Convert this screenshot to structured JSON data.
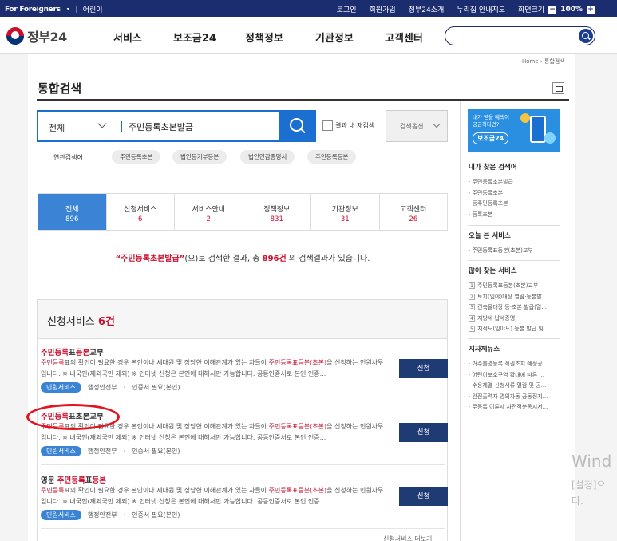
{
  "topbar": {
    "foreigners": "For Foreigners",
    "kids": "어린이",
    "login": "로그인",
    "join": "회원가입",
    "intro": "정부24소개",
    "map": "누리집 안내지도",
    "screen": "화면크기",
    "zoom": "100%",
    "minus": "−",
    "plus": "+"
  },
  "header": {
    "logo": "정부24",
    "nav": [
      "서비스",
      "보조금24",
      "정책정보",
      "기관정보",
      "고객센터"
    ]
  },
  "breadcrumb": "Home › 통합검색",
  "page_title": "통합검색",
  "search": {
    "category": "전체",
    "query": "주민등록초본발급",
    "within_label": "결과 내 재검색",
    "options_label": "검색옵션"
  },
  "related": {
    "label": "연관검색어",
    "terms": [
      "주민등록초본",
      "법인등기부등본",
      "법인인감증명서",
      "주민등록등본"
    ]
  },
  "tabs": [
    {
      "label": "전체",
      "count": "896"
    },
    {
      "label": "신청서비스",
      "count": "6"
    },
    {
      "label": "서비스안내",
      "count": "2"
    },
    {
      "label": "정책정보",
      "count": "831"
    },
    {
      "label": "기관정보",
      "count": "31"
    },
    {
      "label": "고객센터",
      "count": "26"
    }
  ],
  "summary": {
    "keyword": "“주민등록초본발급”",
    "mid": "(으)로 검색한 결과, 총 ",
    "count": "896건",
    "tail": " 의 검색결과가 있습니다."
  },
  "section": {
    "title": "신청서비스",
    "count": "6건"
  },
  "results": [
    {
      "title_pre": "",
      "title_hl1": "주민등록",
      "title_mid": "표",
      "title_hl2": "등본",
      "title_post": "교부",
      "desc_hl1": "주민등록",
      "desc1": "표의 확인이 필요한 경우 본인이나 세대원 및 정당한 이해관계가 있는 자들이 ",
      "desc_hl2": "주민등록표등본(초본)",
      "desc2": "을 신청하는 민원사무입니다. ※ 내국인(재외국민 제외) ※ 인터넷 신청은 본인에 대해서만 가능합니다. 공동인증서로 본인 인증...",
      "badge": "민원서비스",
      "agency": "행정안전부",
      "cert": "인증서 필요(본인)",
      "button": "신청"
    },
    {
      "title_pre": "",
      "title_hl1": "주민등록",
      "title_mid": "표",
      "title_hl2": "초본",
      "title_post": "교부",
      "desc_hl1": "주민등록",
      "desc1": "표의 확인이 필요한 경우 본인이나 세대원 및 정당한 이해관계가 있는 자들이 ",
      "desc_hl2": "주민등록표등본(초본)",
      "desc2": "을 신청하는 민원사무입니다. ※ 내국인(재외국민 제외) ※ 인터넷 신청은 본인에 대해서만 가능합니다. 공동인증서로 본인 인증...",
      "badge": "민원서비스",
      "agency": "행정안전부",
      "cert": "인증서 필요(본인)",
      "button": "신청"
    },
    {
      "title_pre": "영문 ",
      "title_hl1": "주민등록",
      "title_mid": "표",
      "title_hl2": "등본",
      "title_post": "",
      "desc_hl1": "주민등록",
      "desc1": "표의 확인이 필요한 경우 본인이나 세대원 및 정당한 이해관계가 있는 자들이 ",
      "desc_hl2": "주민등록표등본(초본)",
      "desc2": "을 신청하는 민원사무입니다. ※ 내국인(재외국민 제외) ※ 인터넷 신청은 본인에 대해서만 가능합니다. 공동인증서로 본인 인증...",
      "badge": "민원서비스",
      "agency": "행정안전부",
      "cert": "인증서 필요(본인)",
      "button": "신청"
    }
  ],
  "sidebar": {
    "banner_line1": "내가 받을 혜택이",
    "banner_line2": "궁금하다면?",
    "banner_pill": "보조금24",
    "my_search_title": "내가 찾은 검색어",
    "my_search": [
      "주민등록초본발급",
      "주민등록초본",
      "등주민등록초본",
      "등록초본"
    ],
    "today_title": "오늘 본 서비스",
    "today": [
      "주민등록표등본(초본)교부"
    ],
    "popular_title": "많이 찾는 서비스",
    "popular": [
      {
        "n": "1",
        "t": "주민등록표등본(초본)교부"
      },
      {
        "n": "2",
        "t": "토지(임야)대장 열람·등본발..."
      },
      {
        "n": "3",
        "t": "건축물대장 등·초본 발급(열..."
      },
      {
        "n": "4",
        "t": "지방세 납세증명"
      },
      {
        "n": "5",
        "t": "지적도(임야도) 등본 발급 및..."
      }
    ],
    "news_title": "지자체뉴스",
    "news": [
      "거주불명등록 직권조치 예정공...",
      "어린이보호구역 확대에 따른 ...",
      "수용재결 신청서류 열람 및 공...",
      "완전출력자 명의자동 공동정지...",
      "무등록 이륜자 사전적분통지서..."
    ]
  },
  "watermark": {
    "line1": "Wind",
    "line2": "[설정]으",
    "line3": "다."
  },
  "bottom_peek": "신청서비스 더보기"
}
